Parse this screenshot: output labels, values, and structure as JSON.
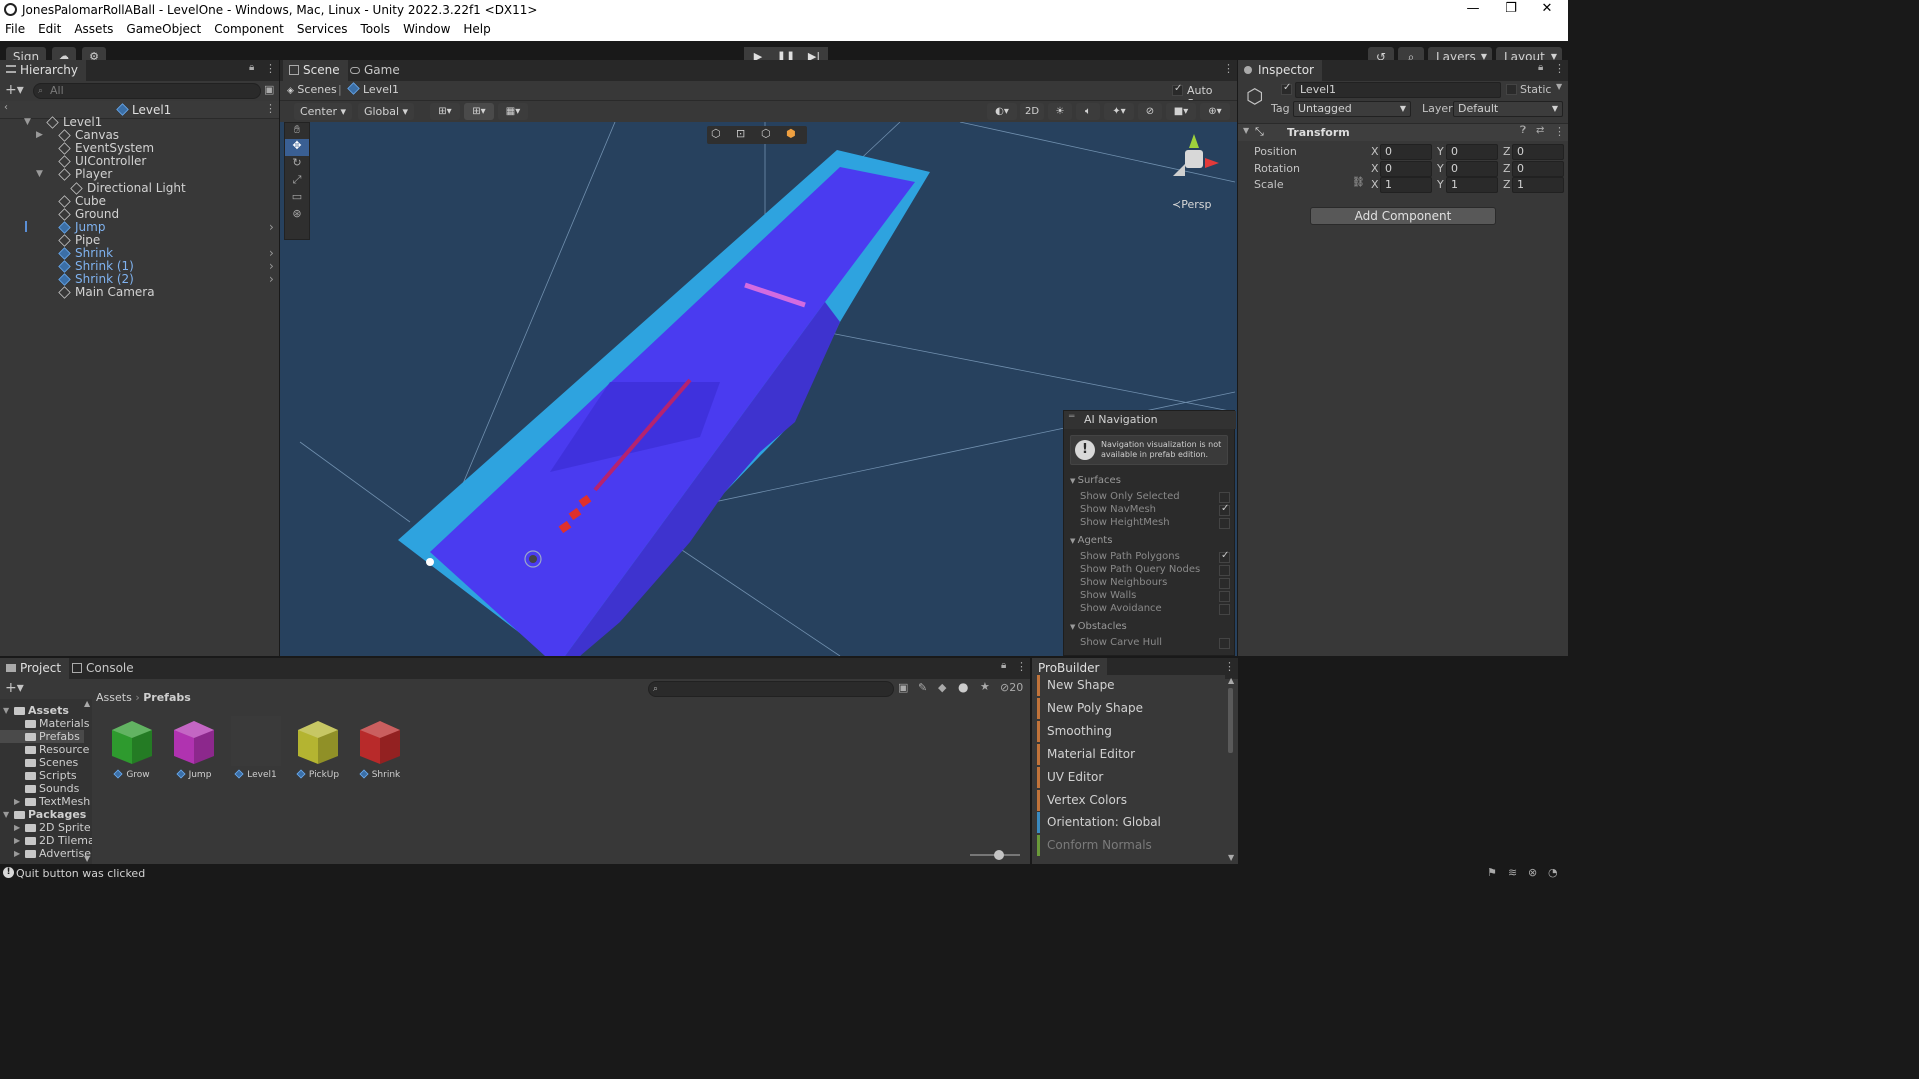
{
  "window": {
    "title": "JonesPalomarRollABall - LevelOne - Windows, Mac, Linux - Unity 2022.3.22f1 <DX11>",
    "minimize": "—",
    "maximize": "❐",
    "close": "✕"
  },
  "menu": [
    "File",
    "Edit",
    "Assets",
    "GameObject",
    "Component",
    "Services",
    "Tools",
    "Window",
    "Help"
  ],
  "toolbar": {
    "sign_in": "Sign in",
    "layers": "Layers",
    "layout": "Layout"
  },
  "hierarchy": {
    "tab": "Hierarchy",
    "search_placeholder": "All",
    "scene_name": "Level1",
    "items": [
      {
        "label": "Level1",
        "blue": false
      },
      {
        "label": "Canvas",
        "blue": false
      },
      {
        "label": "EventSystem",
        "blue": false
      },
      {
        "label": "UIController",
        "blue": false
      },
      {
        "label": "Player",
        "blue": false
      },
      {
        "label": "Directional Light",
        "blue": false
      },
      {
        "label": "Cube",
        "blue": false
      },
      {
        "label": "Ground",
        "blue": false
      },
      {
        "label": "Jump",
        "blue": true
      },
      {
        "label": "Pipe",
        "blue": false
      },
      {
        "label": "Shrink",
        "blue": true
      },
      {
        "label": "Shrink (1)",
        "blue": true
      },
      {
        "label": "Shrink (2)",
        "blue": true
      },
      {
        "label": "Main Camera",
        "blue": false
      }
    ]
  },
  "scene": {
    "tab_scene": "Scene",
    "tab_game": "Game",
    "breadcrumb_root": "Scenes",
    "breadcrumb_current": "Level1",
    "auto_save": "Auto Save",
    "pivot": "Center",
    "space": "Global",
    "mode_2d": "2D",
    "persp": "Persp"
  },
  "ai_nav": {
    "title": "AI Navigation",
    "warning": "Navigation visualization is not available in prefab edition.",
    "surfaces": "Surfaces",
    "show_only_selected": "Show Only Selected",
    "show_navmesh": "Show NavMesh",
    "show_heightmesh": "Show HeightMesh",
    "agents": "Agents",
    "show_path_polygons": "Show Path Polygons",
    "show_path_query_nodes": "Show Path Query Nodes",
    "show_neighbours": "Show Neighbours",
    "show_walls": "Show Walls",
    "show_avoidance": "Show Avoidance",
    "obstacles": "Obstacles",
    "show_carve_hull": "Show Carve Hull"
  },
  "inspector": {
    "tab": "Inspector",
    "object_name": "Level1",
    "static": "Static",
    "tag_label": "Tag",
    "tag_value": "Untagged",
    "layer_label": "Layer",
    "layer_value": "Default",
    "component": "Transform",
    "position_label": "Position",
    "rotation_label": "Rotation",
    "scale_label": "Scale",
    "position": {
      "x": "0",
      "y": "0",
      "z": "0"
    },
    "rotation": {
      "x": "0",
      "y": "0",
      "z": "0"
    },
    "scale": {
      "x": "1",
      "y": "1",
      "z": "1"
    },
    "add_component": "Add Component"
  },
  "project": {
    "tab_project": "Project",
    "tab_console": "Console",
    "breadcrumb_root": "Assets",
    "breadcrumb_current": "Prefabs",
    "hidden_count": "20",
    "tree": [
      {
        "label": "Assets",
        "bold": true,
        "indent": 0
      },
      {
        "label": "Materials",
        "bold": false,
        "indent": 1
      },
      {
        "label": "Prefabs",
        "bold": false,
        "indent": 1
      },
      {
        "label": "Resource",
        "bold": false,
        "indent": 1
      },
      {
        "label": "Scenes",
        "bold": false,
        "indent": 1
      },
      {
        "label": "Scripts",
        "bold": false,
        "indent": 1
      },
      {
        "label": "Sounds",
        "bold": false,
        "indent": 1
      },
      {
        "label": "TextMesh",
        "bold": false,
        "indent": 1
      },
      {
        "label": "Packages",
        "bold": true,
        "indent": 0
      },
      {
        "label": "2D Sprite",
        "bold": false,
        "indent": 1
      },
      {
        "label": "2D Tilema",
        "bold": false,
        "indent": 1
      },
      {
        "label": "Advertise",
        "bold": false,
        "indent": 1
      }
    ],
    "assets": [
      {
        "name": "Grow",
        "color": "#2e9a2e"
      },
      {
        "name": "Jump",
        "color": "#b033b0"
      },
      {
        "name": "Level1",
        "color": "#4a4a4a"
      },
      {
        "name": "PickUp",
        "color": "#b4b431"
      },
      {
        "name": "Shrink",
        "color": "#b82a2a"
      }
    ]
  },
  "probuilder": {
    "tab": "ProBuilder",
    "items": [
      {
        "label": "New Shape",
        "color": "#c0733a",
        "dim": false
      },
      {
        "label": "New Poly Shape",
        "color": "#c0733a",
        "dim": false
      },
      {
        "label": "Smoothing",
        "color": "#c0733a",
        "dim": false
      },
      {
        "label": "Material Editor",
        "color": "#c0733a",
        "dim": false
      },
      {
        "label": "UV Editor",
        "color": "#c0733a",
        "dim": false
      },
      {
        "label": "Vertex Colors",
        "color": "#c0733a",
        "dim": false
      },
      {
        "label": "Orientation: Global",
        "color": "#3a8ac0",
        "dim": false
      },
      {
        "label": "Conform Normals",
        "color": "#6a9a3a",
        "dim": true
      }
    ]
  },
  "status": {
    "message": "Quit button was clicked"
  }
}
